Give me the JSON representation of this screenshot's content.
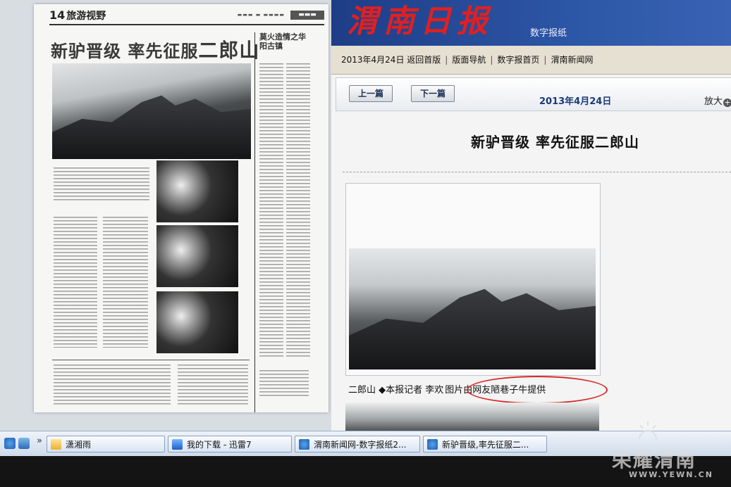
{
  "newspaper_page": {
    "section_number": "14",
    "section_name": "旅游视野",
    "headline_part1": "新驴晋级  率先征服",
    "headline_part2": "二郎山",
    "side_title": "莫火造情之华阳古镇"
  },
  "site": {
    "logo": "渭南日报",
    "subtitle": "数字报纸"
  },
  "nav": {
    "date": "2013年4月24日",
    "items": [
      "返回首版",
      "版面导航",
      "数字报首页",
      "渭南新闻网"
    ]
  },
  "toolbar": {
    "prev_label": "上一篇",
    "next_label": "下一篇",
    "date": "2013年4月24日",
    "zoom_label": "放大",
    "zoom_icon": "plus-circle-icon"
  },
  "article": {
    "title": "新驴晋级  率先征服二郎山",
    "caption_place": "二郎山",
    "caption_reporter": "◆本报记者  李欢",
    "caption_credit": "图片由网友陋巷子牛提供"
  },
  "taskbar": {
    "quick_launch_icons": [
      "ie-icon",
      "desktop-icon"
    ],
    "overflow": "»",
    "tasks": [
      {
        "label": "潇湘雨",
        "icon": "folder-icon"
      },
      {
        "label": "我的下载 - 迅雷7",
        "icon": "thunder-icon"
      },
      {
        "label": "渭南新闻网-数字报纸2...",
        "icon": "ie-icon"
      },
      {
        "label": "新驴晋级,率先征服二...",
        "icon": "ie-icon"
      }
    ]
  },
  "watermark": {
    "text": "荣耀渭南",
    "url": "WWW.YEWN.CN"
  },
  "colors": {
    "banner_blue": "#2c56a6",
    "logo_red": "#e02020",
    "highlight_circle": "#d62b2b",
    "nav_bg": "#e6e0d2"
  }
}
